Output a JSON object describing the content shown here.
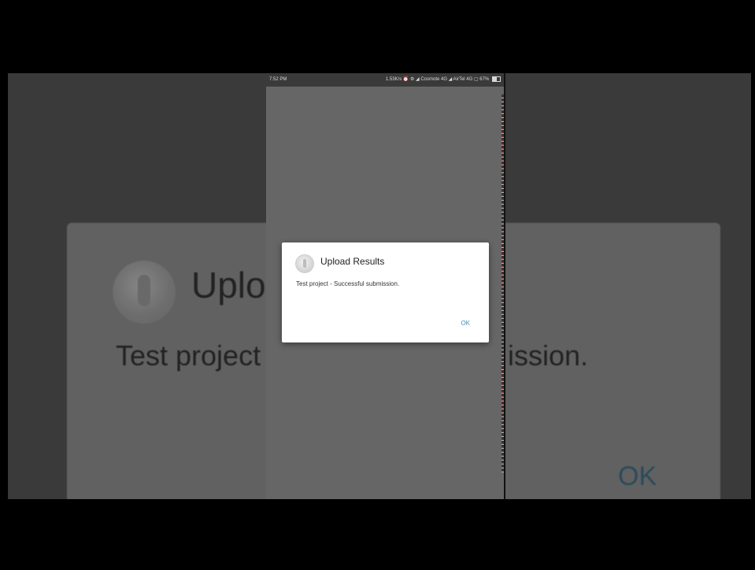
{
  "background": {
    "title_partial": "Uploa",
    "message_left": "Test project",
    "message_right": "ission.",
    "ok_label": "OK"
  },
  "status_bar": {
    "time": "7:52 PM",
    "indicators": "1.53K/s ⏰ ⚙ ◢ Cosmote 4G ◢ AirTel 4G ▢ 67%"
  },
  "dialog": {
    "title": "Upload Results",
    "message": "Test project - Successful submission.",
    "ok_label": "OK",
    "logo_icon": "app-logo-icon"
  },
  "colors": {
    "dialog_bg": "#ffffff",
    "ok_accent": "#4a8fb0",
    "screen_dim": "#666666"
  }
}
